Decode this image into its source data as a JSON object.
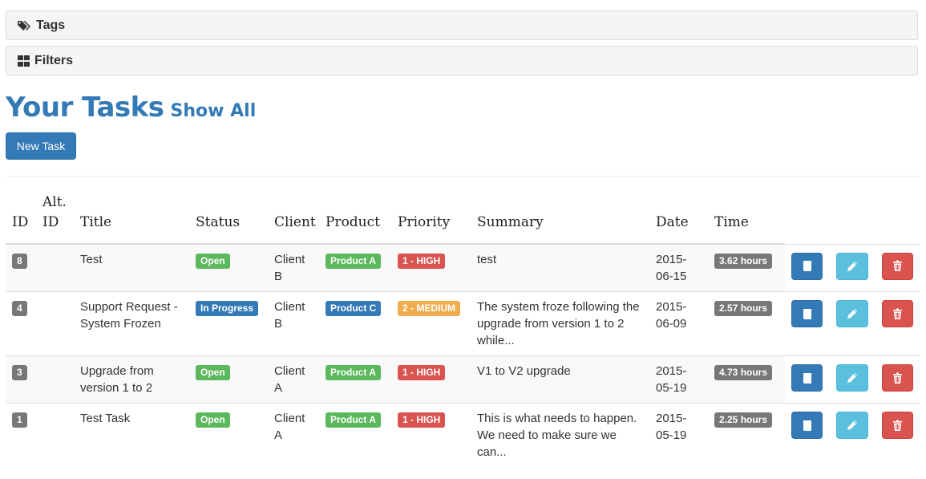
{
  "panels": {
    "tags_label": "Tags",
    "filters_label": "Filters"
  },
  "heading": {
    "title": "Your Tasks",
    "show_all": "Show All"
  },
  "new_task_label": "New Task",
  "colors": {
    "primary": "#337ab7",
    "success": "#5cb85c",
    "danger": "#d9534f",
    "warning": "#f0ad4e",
    "info": "#5bc0de",
    "default": "#777777"
  },
  "table": {
    "headers": {
      "id": "ID",
      "alt_id": "Alt. ID",
      "title": "Title",
      "status": "Status",
      "client": "Client",
      "product": "Product",
      "priority": "Priority",
      "summary": "Summary",
      "date": "Date",
      "time": "Time"
    },
    "rows": [
      {
        "id": "8",
        "alt_id": "",
        "title": "Test",
        "status": "Open",
        "status_color": "#5cb85c",
        "client": "Client B",
        "product": "Product A",
        "product_color": "#5cb85c",
        "priority": "1 - HIGH",
        "priority_color": "#d9534f",
        "summary": "test",
        "date": "2015-06-15",
        "time": "3.62 hours"
      },
      {
        "id": "4",
        "alt_id": "",
        "title": "Support Request - System Frozen",
        "status": "In Progress",
        "status_color": "#337ab7",
        "client": "Client B",
        "product": "Product C",
        "product_color": "#337ab7",
        "priority": "2 - MEDIUM",
        "priority_color": "#f0ad4e",
        "summary": "The system froze following the upgrade from version 1 to 2 while...",
        "date": "2015-06-09",
        "time": "2.57 hours"
      },
      {
        "id": "3",
        "alt_id": "",
        "title": "Upgrade from version 1 to 2",
        "status": "Open",
        "status_color": "#5cb85c",
        "client": "Client A",
        "product": "Product A",
        "product_color": "#5cb85c",
        "priority": "1 - HIGH",
        "priority_color": "#d9534f",
        "summary": "V1 to V2 upgrade",
        "date": "2015-05-19",
        "time": "4.73 hours"
      },
      {
        "id": "1",
        "alt_id": "",
        "title": "Test Task",
        "status": "Open",
        "status_color": "#5cb85c",
        "client": "Client A",
        "product": "Product A",
        "product_color": "#5cb85c",
        "priority": "1 - HIGH",
        "priority_color": "#d9534f",
        "summary": "This is what needs to happen. We need to make sure we can...",
        "date": "2015-05-19",
        "time": "2.25 hours"
      }
    ],
    "row_actions": [
      "view-icon",
      "edit-icon",
      "delete-icon"
    ]
  }
}
